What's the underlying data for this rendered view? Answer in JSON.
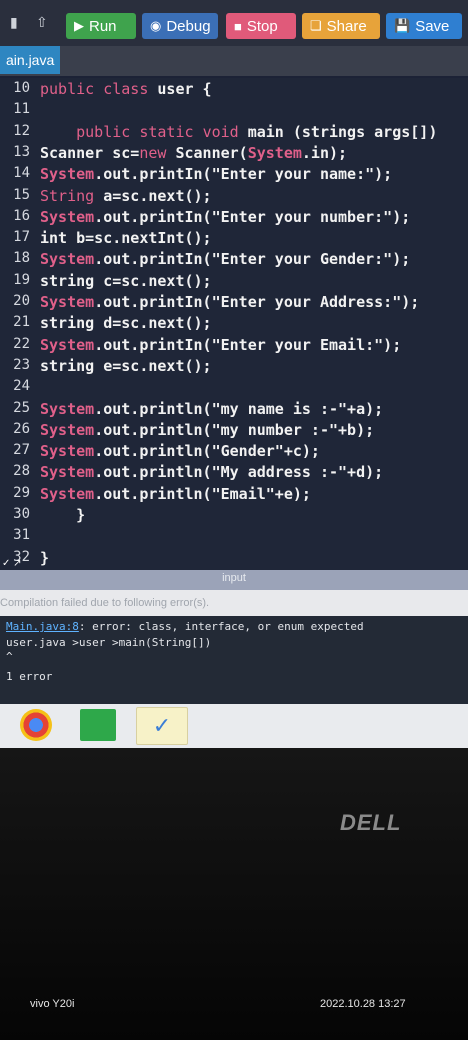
{
  "toolbar": {
    "run": "Run",
    "debug": "Debug",
    "stop": "Stop",
    "share": "Share",
    "save": "Save"
  },
  "tab": {
    "filename": "ain.java"
  },
  "editor": {
    "lines": [
      {
        "num": "10",
        "code": "public class user {"
      },
      {
        "num": "11",
        "code": ""
      },
      {
        "num": "12",
        "code": "    public static void main (strings args[])"
      },
      {
        "num": "13",
        "code": "Scanner sc=new Scanner(System.in);"
      },
      {
        "num": "14",
        "code": "System.out.printIn(\"Enter your name:\");"
      },
      {
        "num": "15",
        "code": "String a=sc.next();"
      },
      {
        "num": "16",
        "code": "System.out.printIn(\"Enter your number:\");"
      },
      {
        "num": "17",
        "code": "int b=sc.nextInt();"
      },
      {
        "num": "18",
        "code": "System.out.printIn(\"Enter your Gender:\");"
      },
      {
        "num": "19",
        "code": "string c=sc.next();"
      },
      {
        "num": "20",
        "code": "System.out.printIn(\"Enter your Address:\");"
      },
      {
        "num": "21",
        "code": "string d=sc.next();"
      },
      {
        "num": "22",
        "code": "System.out.printIn(\"Enter your Email:\");"
      },
      {
        "num": "23",
        "code": "string e=sc.next();"
      },
      {
        "num": "24",
        "code": ""
      },
      {
        "num": "25",
        "code": "System.out.println(\"my name is :-\"+a);"
      },
      {
        "num": "26",
        "code": "System.out.println(\"my number :-\"+b);"
      },
      {
        "num": "27",
        "code": "System.out.println(\"Gender\"+c);"
      },
      {
        "num": "28",
        "code": "System.out.println(\"My address :-\"+d);"
      },
      {
        "num": "29",
        "code": "System.out.println(\"Email\"+e);"
      },
      {
        "num": "30",
        "code": "    }"
      },
      {
        "num": "31",
        "code": ""
      },
      {
        "num": "32",
        "code": "}"
      }
    ]
  },
  "panel": {
    "input_label": "input",
    "status": "Compilation failed due to following error(s).",
    "error_file": "Main.java:8",
    "error_msg": ": error: class, interface, or enum expected",
    "trace": "user.java >user >main(String[])",
    "caret": "^",
    "summary": "1 error"
  },
  "device": {
    "brand": "DELL",
    "camera": "vivo Y20i",
    "timestamp": "2022.10.28 13:27"
  },
  "colors": {
    "run": "#3fa34d",
    "debug": "#3b6fb6",
    "stop": "#e05a7a",
    "share": "#e7a33a",
    "save": "#2f7fd1",
    "keyword": "#e0608a"
  }
}
